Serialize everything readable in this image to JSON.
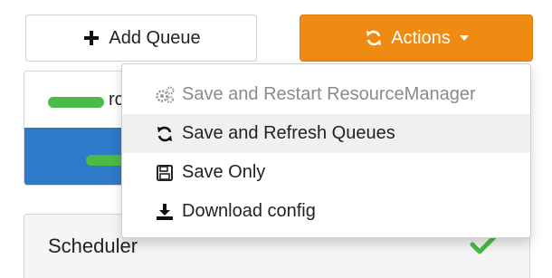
{
  "toolbar": {
    "add_queue_label": "Add Queue",
    "actions_label": "Actions"
  },
  "queue_panel": {
    "visible_label_fragment": "rc"
  },
  "dropdown": {
    "items": [
      {
        "label": "Save and Restart ResourceManager",
        "icon": "gears-icon",
        "disabled": true
      },
      {
        "label": "Save and Refresh Queues",
        "icon": "refresh-icon",
        "disabled": false,
        "hovered": true
      },
      {
        "label": "Save Only",
        "icon": "floppy-disk-icon",
        "disabled": false
      },
      {
        "label": "Download config",
        "icon": "download-icon",
        "disabled": false
      }
    ]
  },
  "scheduler": {
    "title": "Scheduler",
    "status_icon": "check-icon"
  },
  "colors": {
    "actions_bg": "#ef8a12",
    "selected_row_bg": "#2f79c9",
    "capacity_bar": "#4cba46",
    "check": "#4cba46"
  }
}
